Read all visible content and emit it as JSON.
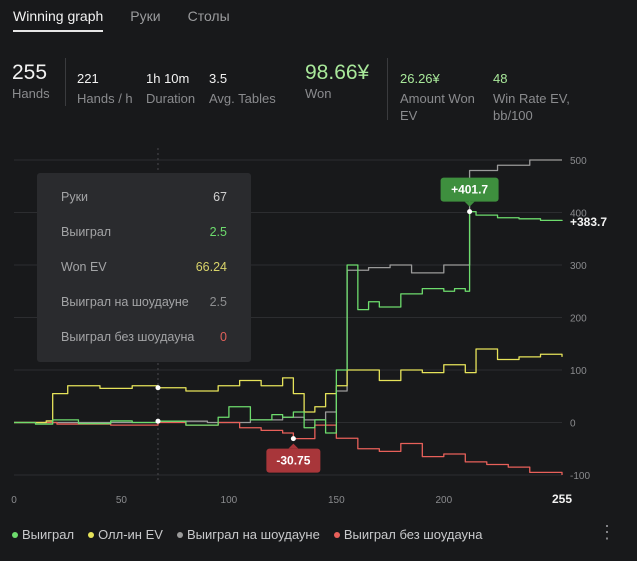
{
  "tabs": [
    "Winning graph",
    "Руки",
    "Столы"
  ],
  "stats": {
    "hands": {
      "value": "255",
      "label": "Hands"
    },
    "hands_per_h": {
      "value": "221",
      "label": "Hands / h"
    },
    "duration": {
      "value": "1h 10m",
      "label": "Duration"
    },
    "avg_tables": {
      "value": "3.5",
      "label": "Avg. Tables"
    },
    "won": {
      "value": "98.66¥",
      "label": "Won"
    },
    "amount_won_ev": {
      "value": "26.26¥",
      "label1": "Amount Won",
      "label2": "EV"
    },
    "win_rate_ev": {
      "value": "48",
      "label1": "Win Rate EV,",
      "label2": "bb/100"
    }
  },
  "tooltip": {
    "rows": [
      {
        "key": "Руки",
        "value": "67",
        "color": "#d0d0d0"
      },
      {
        "key": "Выиграл",
        "value": "2.5",
        "color": "#6ddc6d"
      },
      {
        "key": "Won EV",
        "value": "66.24",
        "color": "#d8d36a"
      },
      {
        "key": "Выиграл на шоудауне",
        "value": "2.5",
        "color": "#8e8f91"
      },
      {
        "key": "Выиграл без шоудауна",
        "value": "0",
        "color": "#e0605a"
      }
    ]
  },
  "colors": {
    "won": "#6ddc6d",
    "ev": "#e6e35a",
    "sd": "#9a9a9a",
    "nsd": "#e8605a",
    "badge_green": "#3e8f3e",
    "badge_red": "#a8363a"
  },
  "chart_data": {
    "type": "line",
    "xlim": [
      0,
      255
    ],
    "ylim": [
      -100,
      500
    ],
    "x_ticks": [
      "0",
      "50",
      "100",
      "150",
      "200",
      "255"
    ],
    "y_ticks": [
      "500",
      "400",
      "300",
      "200",
      "100",
      "0",
      "-100"
    ],
    "max_label": "+401.7",
    "min_label": "-30.75",
    "end_label": "+383.7",
    "hover_x": 67,
    "series": [
      {
        "name": "Выиграл",
        "key": "won",
        "points": [
          [
            0,
            0
          ],
          [
            10,
            -3
          ],
          [
            18,
            5
          ],
          [
            30,
            -2
          ],
          [
            45,
            3
          ],
          [
            55,
            0
          ],
          [
            67,
            2.5
          ],
          [
            80,
            -5
          ],
          [
            95,
            10
          ],
          [
            100,
            30
          ],
          [
            110,
            5
          ],
          [
            120,
            15
          ],
          [
            125,
            10
          ],
          [
            130,
            20
          ],
          [
            135,
            -10
          ],
          [
            140,
            5
          ],
          [
            145,
            -20
          ],
          [
            150,
            100
          ],
          [
            155,
            300
          ],
          [
            160,
            215
          ],
          [
            165,
            230
          ],
          [
            170,
            220
          ],
          [
            180,
            245
          ],
          [
            190,
            255
          ],
          [
            200,
            250
          ],
          [
            205,
            255
          ],
          [
            210,
            250
          ],
          [
            212,
            401.7
          ],
          [
            215,
            395
          ],
          [
            225,
            390
          ],
          [
            235,
            388
          ],
          [
            245,
            385
          ],
          [
            255,
            383.7
          ]
        ]
      },
      {
        "name": "Олл-ин EV",
        "key": "ev",
        "points": [
          [
            0,
            0
          ],
          [
            15,
            3
          ],
          [
            18,
            55
          ],
          [
            25,
            70
          ],
          [
            40,
            65
          ],
          [
            55,
            70
          ],
          [
            67,
            66.24
          ],
          [
            80,
            60
          ],
          [
            95,
            70
          ],
          [
            105,
            80
          ],
          [
            115,
            70
          ],
          [
            125,
            85
          ],
          [
            130,
            55
          ],
          [
            135,
            20
          ],
          [
            140,
            30
          ],
          [
            145,
            55
          ],
          [
            150,
            70
          ],
          [
            155,
            100
          ],
          [
            165,
            100
          ],
          [
            170,
            80
          ],
          [
            180,
            100
          ],
          [
            190,
            95
          ],
          [
            200,
            110
          ],
          [
            210,
            95
          ],
          [
            215,
            140
          ],
          [
            225,
            120
          ],
          [
            235,
            125
          ],
          [
            245,
            130
          ],
          [
            255,
            125
          ]
        ]
      },
      {
        "name": "Выиграл на шоудауне",
        "key": "sd",
        "points": [
          [
            0,
            0
          ],
          [
            20,
            0
          ],
          [
            45,
            0
          ],
          [
            67,
            2.5
          ],
          [
            90,
            0
          ],
          [
            110,
            5
          ],
          [
            125,
            10
          ],
          [
            135,
            5
          ],
          [
            145,
            20
          ],
          [
            150,
            60
          ],
          [
            155,
            290
          ],
          [
            165,
            295
          ],
          [
            175,
            300
          ],
          [
            185,
            285
          ],
          [
            200,
            300
          ],
          [
            212,
            480
          ],
          [
            225,
            490
          ],
          [
            240,
            500
          ],
          [
            255,
            500
          ]
        ]
      },
      {
        "name": "Выиграл без шоудауна",
        "key": "nsd",
        "points": [
          [
            0,
            0
          ],
          [
            20,
            -3
          ],
          [
            45,
            -5
          ],
          [
            67,
            0
          ],
          [
            80,
            -5
          ],
          [
            95,
            0
          ],
          [
            105,
            -10
          ],
          [
            115,
            -15
          ],
          [
            125,
            -20
          ],
          [
            130,
            -30.75
          ],
          [
            140,
            -5
          ],
          [
            150,
            -30
          ],
          [
            160,
            -50
          ],
          [
            170,
            -55
          ],
          [
            180,
            -40
          ],
          [
            190,
            -65
          ],
          [
            200,
            -60
          ],
          [
            210,
            -75
          ],
          [
            220,
            -80
          ],
          [
            230,
            -85
          ],
          [
            240,
            -95
          ],
          [
            255,
            -100
          ]
        ]
      }
    ]
  }
}
